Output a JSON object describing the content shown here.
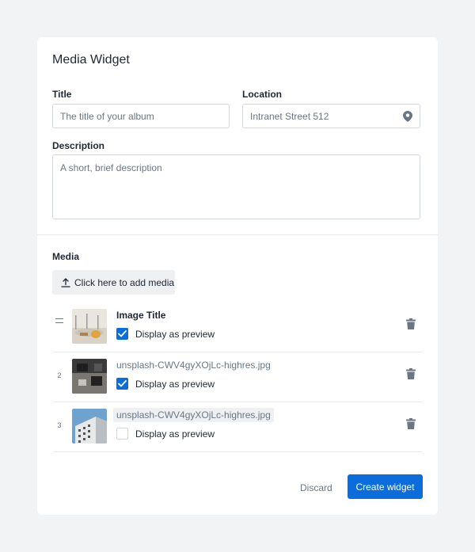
{
  "widget": {
    "title": "Media Widget"
  },
  "form": {
    "title_label": "Title",
    "title_placeholder": "The title of your album",
    "location_label": "Location",
    "location_value": "Intranet Street 512",
    "location_icon": "map-pin-icon",
    "description_label": "Description",
    "description_placeholder": "A short, brief description"
  },
  "media": {
    "label": "Media",
    "add_button_label": "Click here to add media",
    "add_icon": "upload-icon",
    "items": [
      {
        "index": "",
        "title": "Image Title",
        "preview_label": "Display as preview",
        "preview_checked": true
      },
      {
        "index": "2",
        "title": "unsplash-CWV4gyXOjLc-highres.jpg",
        "preview_label": "Display as preview",
        "preview_checked": true
      },
      {
        "index": "3",
        "title": "unsplash-CWV4gyXOjLc-highres.jpg",
        "preview_label": "Display as preview",
        "preview_checked": false
      }
    ]
  },
  "actions": {
    "discard_label": "Discard",
    "create_label": "Create widget"
  },
  "colors": {
    "accent": "#0a6ddb",
    "background": "#f2f3f5",
    "muted_text": "#6b7684"
  }
}
